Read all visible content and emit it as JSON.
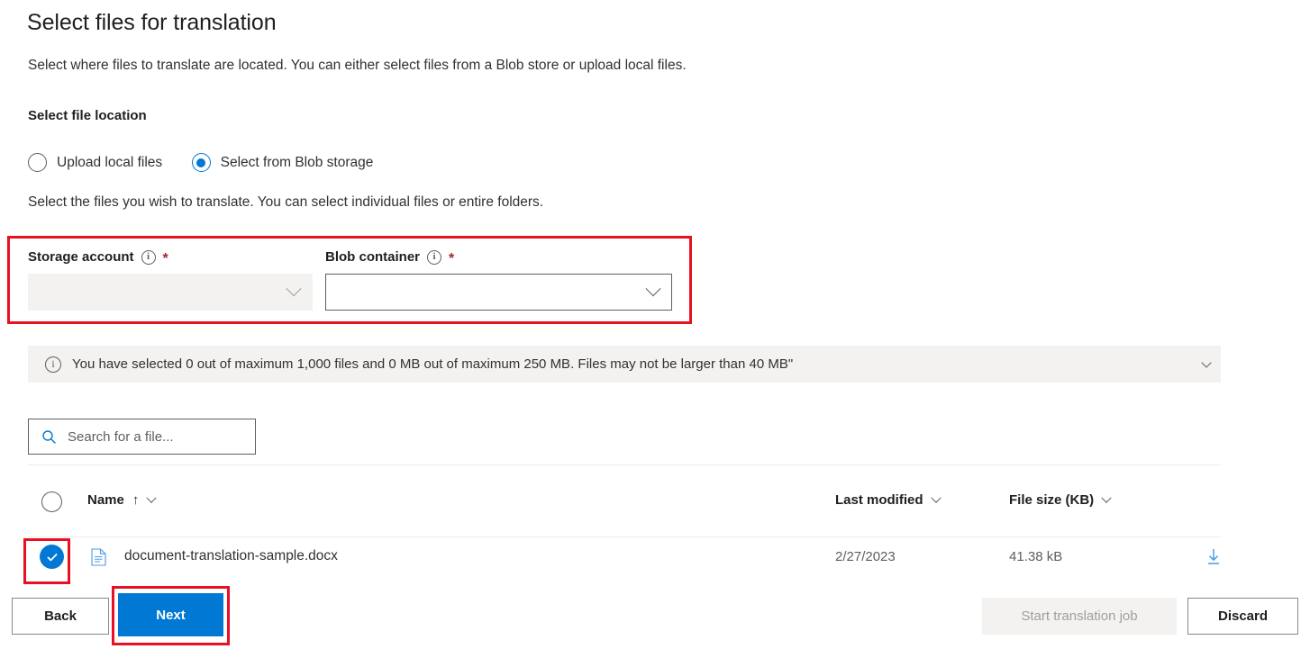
{
  "header": {
    "title": "Select files for translation",
    "subtitle": "Select where files to translate are located. You can either select files from a Blob store or upload local files.",
    "section_label": "Select file location"
  },
  "location_choice": {
    "options": [
      {
        "label": "Upload local files",
        "selected": false
      },
      {
        "label": "Select from Blob storage",
        "selected": true
      }
    ],
    "helper_text": "Select the files you wish to translate. You can select individual files or entire folders."
  },
  "fields": {
    "storage_account": {
      "label": "Storage account",
      "info_icon": "info-icon",
      "required_marker": "*",
      "value": "",
      "disabled": true,
      "chevron_icon": "chevron-down-icon"
    },
    "blob_container": {
      "label": "Blob container",
      "info_icon": "info-icon",
      "required_marker": "*",
      "value": "",
      "disabled": false,
      "chevron_icon": "chevron-down-icon"
    }
  },
  "info_bar": {
    "icon": "info-icon",
    "message": "You have selected 0 out of maximum 1,000 files and 0 MB out of maximum 250 MB. Files may not be larger than 40 MB\"",
    "expand_icon": "chevron-down-icon"
  },
  "search": {
    "icon": "search-icon",
    "placeholder": "Search for a file...",
    "value": ""
  },
  "file_table": {
    "select_all_checked": false,
    "columns": {
      "name": {
        "label": "Name",
        "sort_indicator": "↑",
        "menu_icon": "chevron-down-icon"
      },
      "last_modified": {
        "label": "Last modified",
        "menu_icon": "chevron-down-icon"
      },
      "file_size": {
        "label": "File size (KB)",
        "menu_icon": "chevron-down-icon"
      }
    },
    "rows": [
      {
        "selected": true,
        "file_icon": "document-icon",
        "name": "document-translation-sample.docx",
        "last_modified": "2/27/2023",
        "file_size": "41.38 kB",
        "download_icon": "download-icon"
      }
    ]
  },
  "footer": {
    "back_label": "Back",
    "next_label": "Next",
    "start_label": "Start translation job",
    "discard_label": "Discard"
  },
  "colors": {
    "accent": "#0078d4",
    "annotation": "#e81123",
    "disabled_bg": "#f3f2f1",
    "required_star": "#a4262c"
  }
}
